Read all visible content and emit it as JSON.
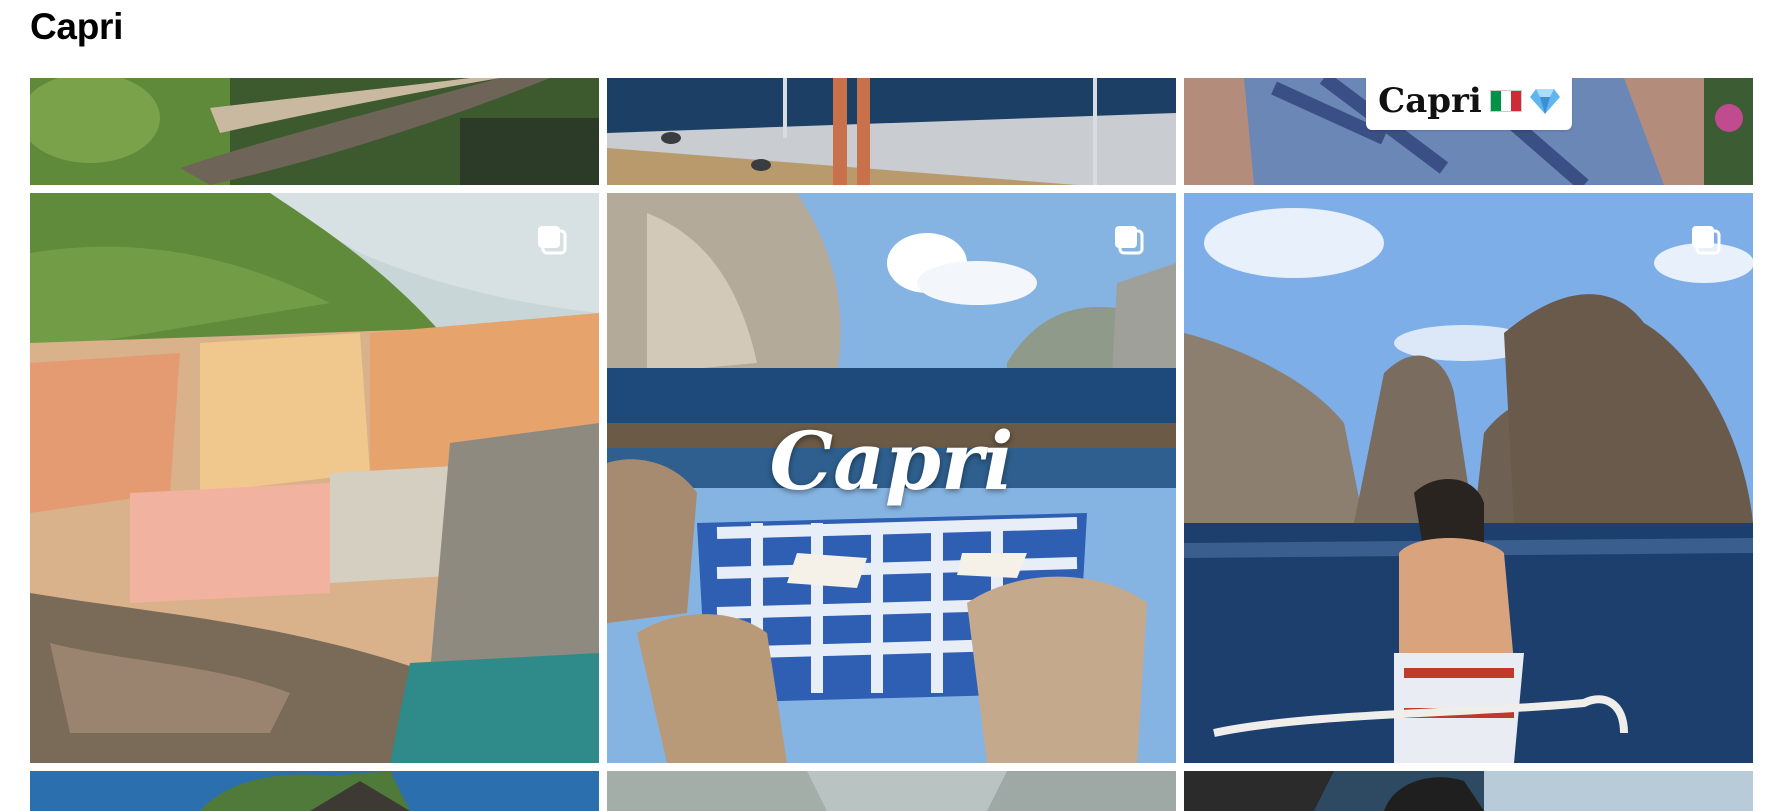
{
  "page": {
    "title": "Capri"
  },
  "posts": [
    {
      "id": "row0-col0",
      "kind": "cropped"
    },
    {
      "id": "row0-col1",
      "kind": "cropped"
    },
    {
      "id": "row0-col2",
      "kind": "cropped",
      "sticker_text": "Capri"
    },
    {
      "id": "row1-col0",
      "kind": "carousel"
    },
    {
      "id": "row1-col1",
      "kind": "carousel",
      "caption": "Capri"
    },
    {
      "id": "row1-col2",
      "kind": "carousel"
    },
    {
      "id": "row2-col0",
      "kind": "cropped"
    },
    {
      "id": "row2-col1",
      "kind": "cropped"
    },
    {
      "id": "row2-col2",
      "kind": "cropped"
    }
  ],
  "icons": {
    "carousel": "multiple-photos-icon",
    "flag": "italy-flag-icon",
    "gem": "gem-icon"
  },
  "colors": {
    "sea": "#1d4a7a",
    "sky": "#9cc3e8",
    "check": "#2f5fb3",
    "flag_green": "#009246",
    "flag_red": "#ce2b37"
  }
}
